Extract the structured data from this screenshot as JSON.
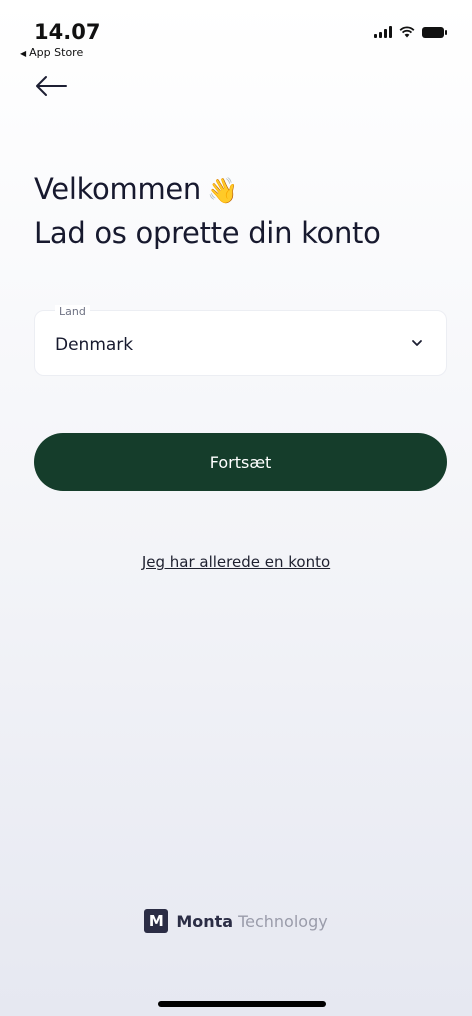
{
  "status_bar": {
    "time": "14.07",
    "back_app": "App Store"
  },
  "header": {
    "title": "Velkommen",
    "wave_emoji": "👋",
    "subtitle": "Lad os oprette din konto"
  },
  "country_field": {
    "label": "Land",
    "value": "Denmark"
  },
  "continue_button": {
    "label": "Fortsæt"
  },
  "login_link": {
    "label": "Jeg har allerede en konto"
  },
  "footer": {
    "logo_letter": "M",
    "brand_name": "Monta",
    "brand_suffix": "Technology"
  },
  "colors": {
    "primary_button": "#153d2b",
    "text_primary": "#17192e",
    "brand_logo_bg": "#2b2d45"
  },
  "icons": {
    "back": "arrow-left-icon",
    "dropdown": "chevron-down-icon",
    "signal": "signal-icon",
    "wifi": "wifi-icon",
    "battery": "battery-icon"
  }
}
